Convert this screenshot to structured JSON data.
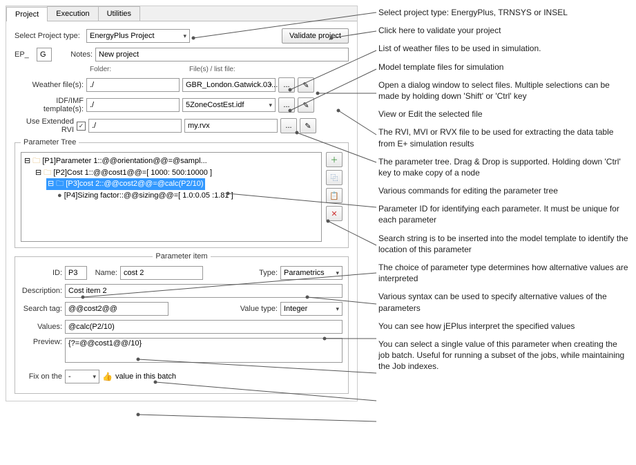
{
  "tabs": {
    "project": "Project",
    "execution": "Execution",
    "utilities": "Utilities"
  },
  "labels": {
    "select_project_type": "Select Project type:",
    "validate": "Validate project",
    "ep": "EP_",
    "g": "G",
    "notes": "Notes:",
    "folder": "Folder:",
    "files": "File(s) / list file:",
    "weather": "Weather file(s):",
    "idf": "IDF/IMF template(s):",
    "use_rvi": "Use Extended RVI",
    "param_tree_title": "Parameter Tree",
    "param_item_title": "Parameter item",
    "id": "ID:",
    "name": "Name:",
    "type": "Type:",
    "desc": "Description:",
    "search_tag": "Search tag:",
    "value_type": "Value type:",
    "values": "Values:",
    "preview": "Preview:",
    "fix_on": "Fix on the",
    "fix_suffix": "value in this batch"
  },
  "fields": {
    "project_type": "EnergyPlus Project",
    "notes_val": "New project",
    "weather_folder": "./",
    "weather_file": "GBR_London.Gatwick.03...",
    "idf_folder": "./",
    "idf_file": "5ZoneCostEst.idf",
    "rvi_checked": "✓",
    "rvi_folder": "./",
    "rvi_file": "my.rvx",
    "id_val": "P3",
    "name_val": "cost 2",
    "type_val": "Parametrics",
    "desc_val": "Cost item 2",
    "search_tag_val": "@@cost2@@",
    "value_type_val": "Integer",
    "values_val": "@calc(P2/10)",
    "preview_val": "{?=@@cost1@@/10}",
    "fix_val": "-"
  },
  "tree": {
    "n1": "[P1]Parameter 1::@@orientation@@=@sampl...",
    "n2": "[P2]Cost 1::@@cost1@@=[ 1000: 500:10000 ]",
    "n3": "[P3]cost 2::@@cost2@@=@calc(P2/10)",
    "n4": "[P4]Sizing factor::@@sizing@@=[ 1.0:0.05 :1.81 ]"
  },
  "icons": {
    "browse": "...",
    "edit": "✎",
    "add": "＋",
    "copy": "⿻",
    "delete": "✕",
    "paste": "📋",
    "thumb": "👍"
  },
  "annotations": {
    "a1": "Select project type: EnergyPlus, TRNSYS or INSEL",
    "a2": "Click here to validate your project",
    "a3": "List of weather files to be used in simulation.",
    "a4": "Model template files for simulation",
    "a5": "Open a dialog window to select files. Multiple selections can be made by holding down 'Shift' or 'Ctrl' key",
    "a6": "View or Edit the selected file",
    "a7": "The RVI, MVI or RVX file to be used for extracting the data table from E+ simulation results",
    "a8": "The parameter tree. Drag & Drop is supported. Holding down 'Ctrl' key to make copy of a node",
    "a9": "Various commands for editing the parameter tree",
    "a10": "Parameter ID for identifying each parameter. It must be unique for each parameter",
    "a11": "Search string is to be inserted into the model template to identify the location of this parameter",
    "a12": "The choice of parameter type determines how alternative values are interpreted",
    "a13": "Various syntax can be used to specify alternative values of the parameters",
    "a14": "You can see how jEPlus interpret the specified values",
    "a15": "You can select a single value of this parameter when creating the job batch. Useful for running a subset of the jobs, while maintaining the Job indexes."
  }
}
